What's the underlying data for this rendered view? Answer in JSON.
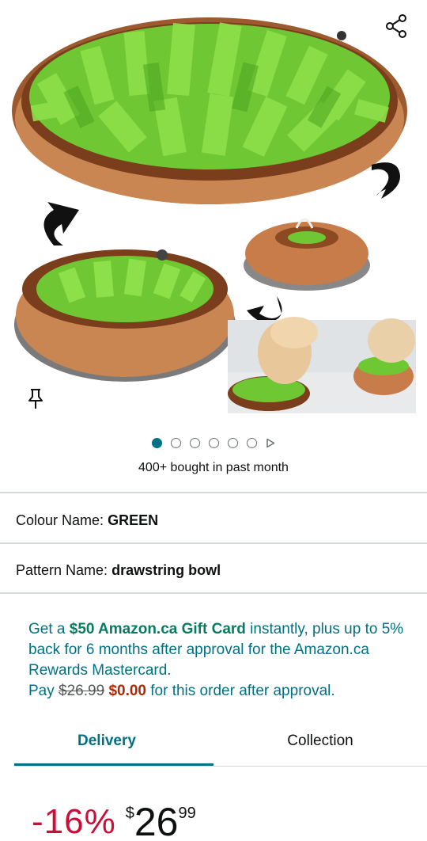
{
  "gallery": {
    "image_alt": "Green felt snuffle mat drawstring bowl",
    "dot_count": 6,
    "active_index": 0
  },
  "bought_text": "400+ bought in past month",
  "colour": {
    "label": "Colour Name:",
    "value": "GREEN"
  },
  "pattern": {
    "label": "Pattern Name:",
    "value": "drawstring bowl"
  },
  "promo": {
    "part1": "Get a ",
    "gift": "$50 Amazon.ca Gift Card",
    "part2": " instantly, plus up to 5% back for 6 months after approval for the Amazon.ca Rewards Mastercard.",
    "pay": "Pay ",
    "old_price": "$26.99",
    "new_price": "$0.00",
    "part3": " for this order after approval."
  },
  "tabs": [
    {
      "label": "Delivery",
      "active": true
    },
    {
      "label": "Collection",
      "active": false
    }
  ],
  "price": {
    "discount": "-16%",
    "currency": "$",
    "whole": "26",
    "fraction": "99"
  },
  "colors": {
    "accent": "#007185",
    "deal": "#cc0c39",
    "gift_green": "#067d62",
    "pay_red": "#b12704"
  },
  "icons": [
    "share-icon",
    "pin-icon",
    "play-icon"
  ]
}
